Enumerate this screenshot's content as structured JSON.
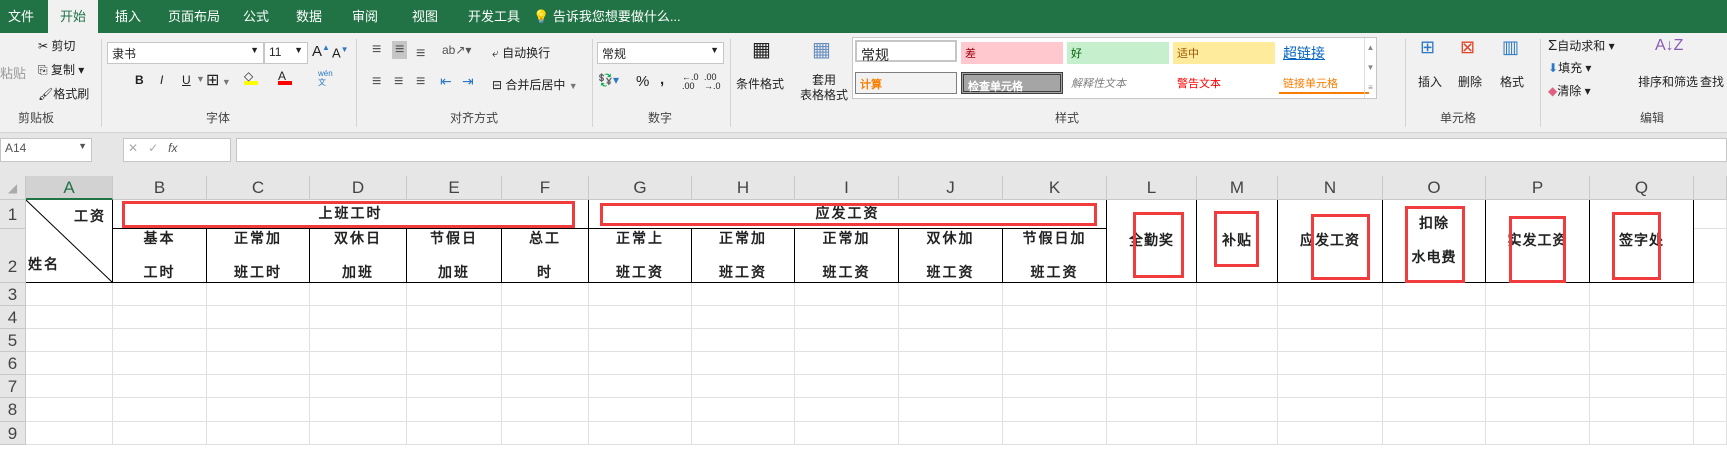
{
  "tabs": {
    "items": [
      "文件",
      "开始",
      "插入",
      "页面布局",
      "公式",
      "数据",
      "审阅",
      "视图",
      "开发工具"
    ],
    "active": "开始",
    "tell_me": "告诉我您想要做什么..."
  },
  "ribbon": {
    "clipboard": {
      "label": "剪贴板",
      "paste": "粘贴",
      "cut": "剪切",
      "copy": "复制",
      "format_painter": "格式刷"
    },
    "font": {
      "label": "字体",
      "font_name": "隶书",
      "font_size": "11",
      "bold": "B",
      "italic": "I",
      "underline": "U",
      "wen": "wén\n文",
      "highlight_color": "#ffff00",
      "font_color": "#ff0000"
    },
    "alignment": {
      "label": "对齐方式",
      "wrap_text": "自动换行",
      "merge_center": "合并后居中"
    },
    "number": {
      "label": "数字",
      "format": "常规",
      "percent": "%",
      "comma": ","
    },
    "styles": {
      "label": "样式",
      "conditional": "条件格式",
      "table_format": "套用\n表格格式",
      "cells": [
        {
          "text": "常规",
          "bg": "#ffffff",
          "color": "#000000"
        },
        {
          "text": "差",
          "bg": "#ffc7ce",
          "color": "#9c0006"
        },
        {
          "text": "好",
          "bg": "#c6efce",
          "color": "#006100"
        },
        {
          "text": "适中",
          "bg": "#ffeb9c",
          "color": "#9c5700"
        },
        {
          "text": "超链接",
          "bg": "#ffffff",
          "color": "#0563c1"
        },
        {
          "text": "计算",
          "bg": "#f2f2f2",
          "color": "#fa7d00"
        },
        {
          "text": "检查单元格",
          "bg": "#a5a5a5",
          "color": "#ffffff"
        },
        {
          "text": "解释性文本",
          "bg": "#ffffff",
          "color": "#7f7f7f"
        },
        {
          "text": "警告文本",
          "bg": "#ffffff",
          "color": "#ff0000"
        },
        {
          "text": "链接单元格",
          "bg": "#ffffff",
          "color": "#fa7d00"
        }
      ]
    },
    "cells_group": {
      "label": "单元格",
      "insert": "插入",
      "delete": "删除",
      "format": "格式"
    },
    "editing": {
      "label": "编辑",
      "autosum": "自动求和",
      "fill": "填充",
      "clear": "清除",
      "sort_filter": "排序和筛选",
      "find": "查找"
    }
  },
  "formula_bar": {
    "name_box": "A14",
    "fx": "fx",
    "value": ""
  },
  "sheet": {
    "columns": [
      "A",
      "B",
      "C",
      "D",
      "E",
      "F",
      "G",
      "H",
      "I",
      "J",
      "K",
      "L",
      "M",
      "N",
      "O",
      "P",
      "Q"
    ],
    "rows": [
      "1",
      "2",
      "3",
      "4",
      "5",
      "6",
      "7",
      "8",
      "9"
    ],
    "a1_top": "工资",
    "a1_bottom": "姓名",
    "merged_b1": "上班工时",
    "merged_g1": "应发工资",
    "row2": [
      "基本\n工时",
      "正常加\n班工时",
      "双休日\n加班",
      "节假日\n加班",
      "总工\n时",
      "正常上\n班工资",
      "正常加\n班工资",
      "正常加\n班工资",
      "双休加\n班工资",
      "节假日加\n班工资"
    ],
    "merged_lq": [
      "全勤奖",
      "补贴",
      "应发工资",
      "扣除\n水电费",
      "实发工资",
      "签字处"
    ],
    "annotation_color": "#f03c3c"
  }
}
